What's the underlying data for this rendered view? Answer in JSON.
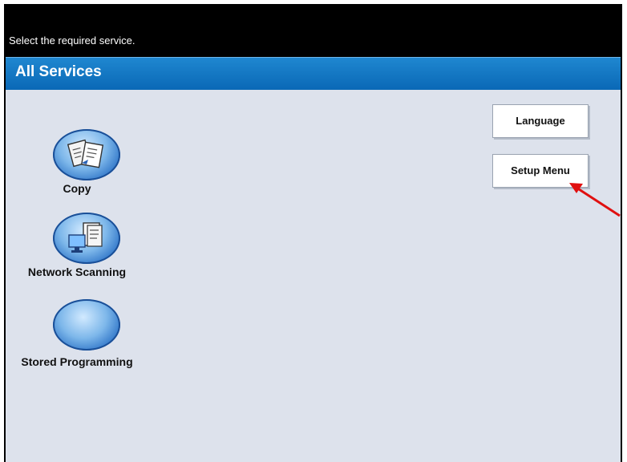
{
  "header": {
    "prompt": "Select the required service."
  },
  "titlebar": {
    "title": "All Services"
  },
  "services": [
    {
      "label": "Copy",
      "icon": "copy-icon"
    },
    {
      "label": "Network Scanning",
      "icon": "network-scanning-icon"
    },
    {
      "label": "Stored Programming",
      "icon": "stored-programming-icon"
    }
  ],
  "buttons": {
    "language": "Language",
    "setup_menu": "Setup Menu"
  },
  "annotation": {
    "arrow_color": "#e01010"
  },
  "colors": {
    "title_bar": "#0a68b6",
    "background": "#dde2ec",
    "header": "#000000"
  }
}
